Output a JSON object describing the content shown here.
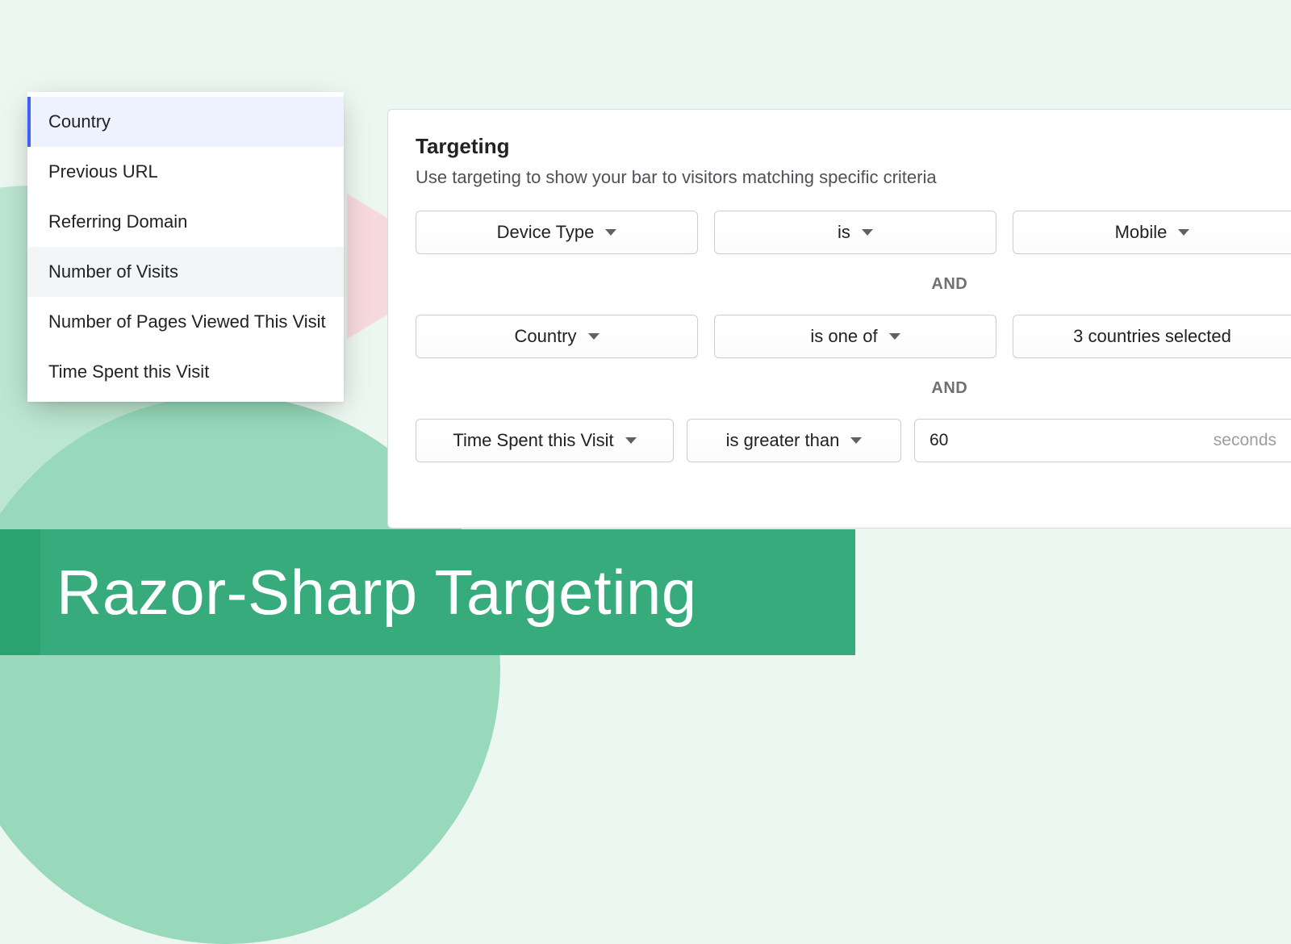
{
  "sidebar": {
    "items": [
      {
        "label": "Country"
      },
      {
        "label": "Previous URL"
      },
      {
        "label": "Referring Domain"
      },
      {
        "label": "Number of Visits"
      },
      {
        "label": "Number of Pages Viewed This Visit"
      },
      {
        "label": "Time Spent this Visit"
      }
    ]
  },
  "panel": {
    "title": "Targeting",
    "subtitle": "Use targeting to show your bar to visitors matching specific criteria",
    "joiner": "AND",
    "rules": [
      {
        "field": "Device Type",
        "op": "is",
        "value": "Mobile"
      },
      {
        "field": "Country",
        "op": "is one of",
        "value": "3 countries selected"
      },
      {
        "field": "Time Spent this Visit",
        "op": "is greater than",
        "value": "60",
        "unit": "seconds"
      }
    ]
  },
  "banner": {
    "title": "Razor-Sharp Targeting"
  }
}
